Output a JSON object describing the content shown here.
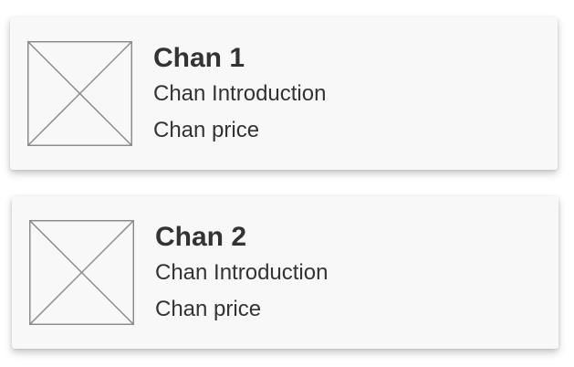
{
  "products": [
    {
      "title": "Chan 1",
      "introduction": "Chan Introduction",
      "price": "Chan price",
      "image_icon": "image-placeholder-icon"
    },
    {
      "title": "Chan 2",
      "introduction": "Chan Introduction",
      "price": "Chan price",
      "image_icon": "image-placeholder-icon"
    }
  ],
  "colors": {
    "card_background": "#f8f8f8",
    "text": "#333333",
    "placeholder_stroke": "#8c8c8c"
  }
}
